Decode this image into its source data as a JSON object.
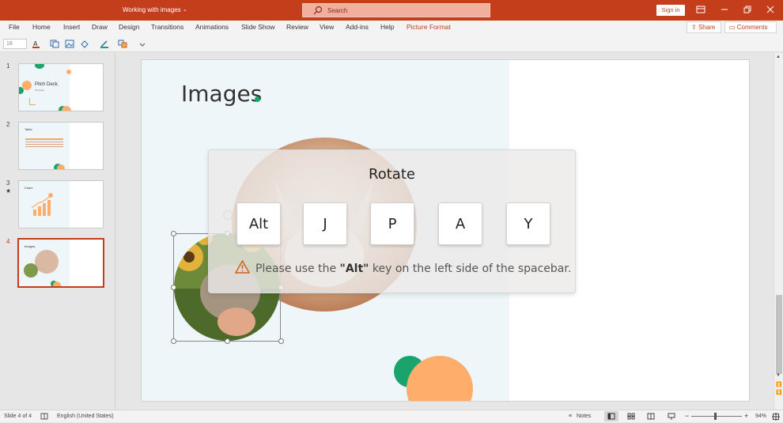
{
  "window": {
    "title": "Working with images",
    "title_caret": "⌄",
    "search_placeholder": "Search",
    "sign_in": "Sign in"
  },
  "menu": {
    "items": [
      "File",
      "Home",
      "Insert",
      "Draw",
      "Design",
      "Transitions",
      "Animations",
      "Slide Show",
      "Review",
      "View",
      "Add-ins",
      "Help",
      "Picture Format"
    ],
    "active": "Picture Format",
    "share": "Share",
    "comments": "Comments"
  },
  "toolbar": {
    "font_size": "18"
  },
  "thumbnails": [
    {
      "number": "1",
      "label": "Pitch Deck.",
      "sublabel": "Template"
    },
    {
      "number": "2",
      "label": "Table."
    },
    {
      "number": "3",
      "label": "Chart.",
      "star": "★"
    },
    {
      "number": "4",
      "label": "Images.",
      "selected": true
    }
  ],
  "slide": {
    "title": "Images"
  },
  "shortcut_overlay": {
    "title": "Rotate",
    "keys": [
      "Alt",
      "J",
      "P",
      "A",
      "Y"
    ],
    "warning_prefix": "Please use the ",
    "warning_key": "\"Alt\"",
    "warning_suffix": " key on the left side of the spacebar."
  },
  "statusbar": {
    "slide_info": "Slide 4 of 4",
    "language": "English (United States)",
    "notes": "Notes",
    "zoom_minus": "−",
    "zoom_plus": "+",
    "zoom": "94%"
  },
  "colors": {
    "brand": "#c43e1c",
    "green": "#1aa36b",
    "orange": "#ffad6b"
  }
}
